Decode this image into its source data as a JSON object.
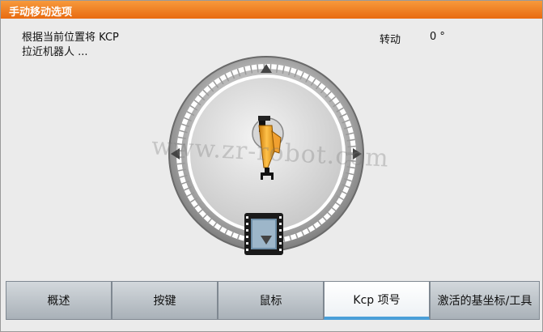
{
  "window": {
    "title": "手动移动选项"
  },
  "info": {
    "description_line1": "根据当前位置将 KCP",
    "description_line2": "拉近机器人 ...",
    "rotation_label": "转动",
    "rotation_value": "0 °"
  },
  "watermark": "www.zr-robot.com",
  "tabs": [
    {
      "label": "概述",
      "active": false
    },
    {
      "label": "按键",
      "active": false
    },
    {
      "label": "鼠标",
      "active": false
    },
    {
      "label": "Kcp 项号",
      "active": true
    },
    {
      "label": "激活的基坐标/工具",
      "active": false
    }
  ],
  "colors": {
    "title_bar": "#ee7a1c",
    "active_tab_underline": "#4a9fd8",
    "robot_orange": "#f2a21a"
  },
  "icons": {
    "robot": "robot-arm-icon",
    "kcp": "kcp-pendant-icon",
    "arrows": [
      "arrow-up-icon",
      "arrow-down-icon",
      "arrow-left-icon",
      "arrow-right-icon"
    ]
  }
}
